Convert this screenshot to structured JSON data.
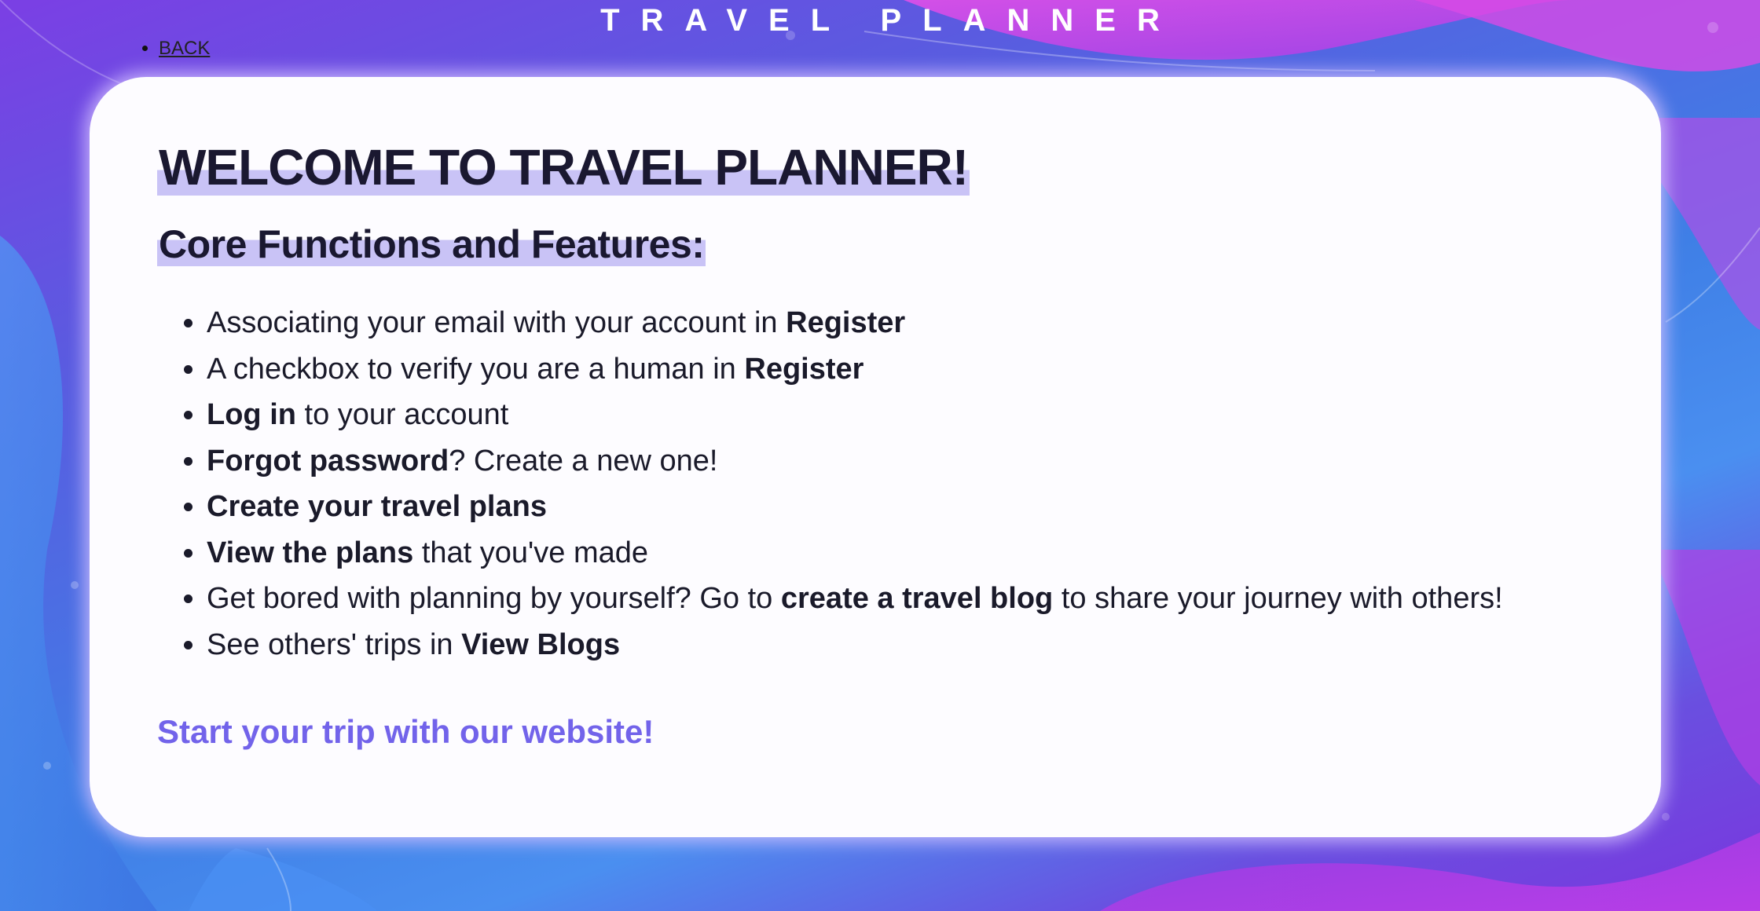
{
  "header": {
    "site_title": "TRAVEL PLANNER"
  },
  "nav": {
    "back_label": "BACK"
  },
  "main": {
    "welcome_title": "WELCOME TO TRAVEL PLANNER!",
    "features_heading": "Core Functions and Features:",
    "features": [
      {
        "before": "Associating your email with your account in ",
        "bold": "Register",
        "after": ""
      },
      {
        "before": "A checkbox to verify you are a human in ",
        "bold": "Register",
        "after": ""
      },
      {
        "before": "",
        "bold": "Log in",
        "after": " to your account"
      },
      {
        "before": "",
        "bold": "Forgot password",
        "after": "? Create a new one!"
      },
      {
        "before": "",
        "bold": "Create your travel plans",
        "after": ""
      },
      {
        "before": "",
        "bold": "View the plans",
        "after": " that you've made"
      },
      {
        "before": "Get bored with planning by yourself? Go to ",
        "bold": "create a travel blog",
        "after": " to share your journey with others!"
      },
      {
        "before": "See others' trips in ",
        "bold": "View Blogs",
        "after": ""
      }
    ],
    "cta": "Start your trip with our website!"
  },
  "colors": {
    "accent": "#7263ea",
    "highlight": "#c9c3f6",
    "background_start": "#7b3fe4",
    "background_end": "#3f7fe6",
    "card": "#fdfcff"
  }
}
